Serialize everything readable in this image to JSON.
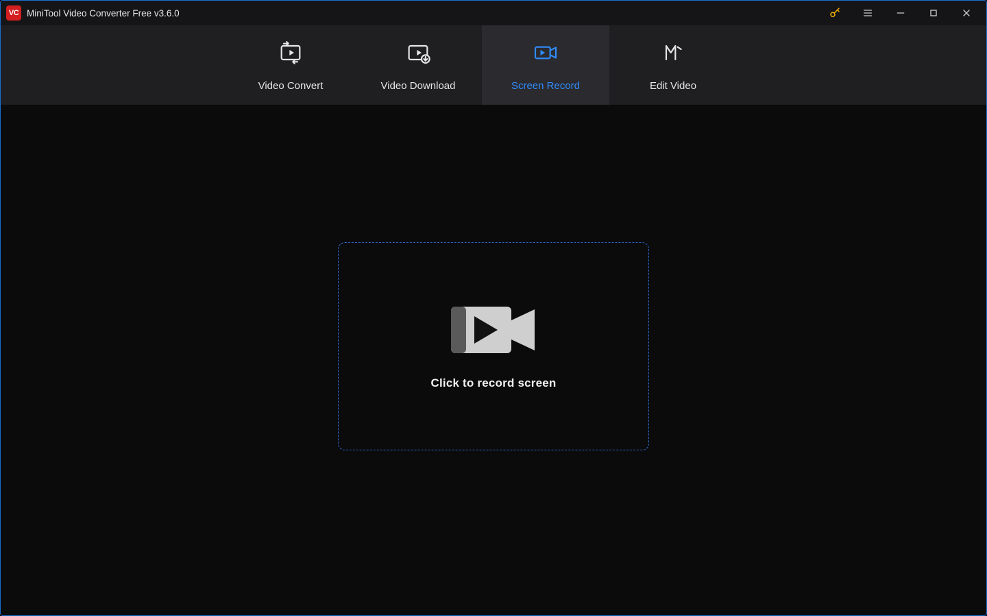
{
  "window": {
    "title": "MiniTool Video Converter Free v3.6.0"
  },
  "titlebar": {
    "icons": {
      "logo": "app-logo",
      "key": "key-icon",
      "menu": "hamburger-icon",
      "minimize": "minimize-icon",
      "maximize": "maximize-icon",
      "close": "close-icon"
    }
  },
  "tabs": [
    {
      "id": "video-convert",
      "label": "Video Convert",
      "icon": "convert-icon",
      "active": false
    },
    {
      "id": "video-download",
      "label": "Video Download",
      "icon": "download-icon",
      "active": false
    },
    {
      "id": "screen-record",
      "label": "Screen Record",
      "icon": "record-icon",
      "active": true
    },
    {
      "id": "edit-video",
      "label": "Edit Video",
      "icon": "edit-icon",
      "active": false
    }
  ],
  "main": {
    "record_prompt": "Click to record screen",
    "record_icon": "camcorder-icon"
  },
  "colors": {
    "accent_blue": "#2f8cff",
    "border_blue": "#2f6ad0",
    "window_border": "#1c6dd0",
    "bg_dark": "#0b0b0c",
    "bg_tabstrip": "#1f1f22",
    "bg_tab_active": "#2b2b2f",
    "logo_red": "#d31f1f",
    "key_gold": "#f2b200"
  }
}
